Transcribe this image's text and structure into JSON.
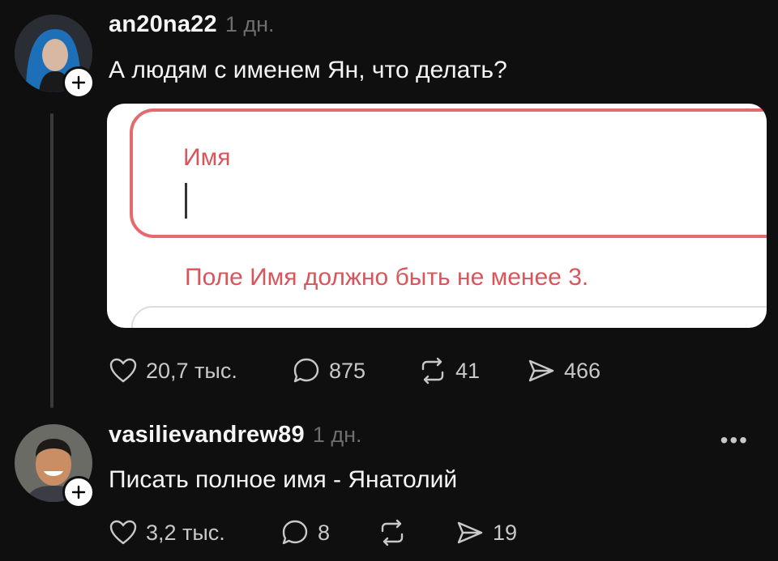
{
  "posts": [
    {
      "username": "an20na22",
      "time": "1 дн.",
      "text": "А людям с именем Ян, что делать?",
      "embed": {
        "field_label": "Имя",
        "error_text": "Поле Имя должно быть не менее 3."
      },
      "stats": {
        "likes": "20,7 тыс.",
        "comments": "875",
        "reposts": "41",
        "shares": "466"
      }
    },
    {
      "username": "vasilievandrew89",
      "time": "1 дн.",
      "text": "Писать полное имя - Янатолий",
      "stats": {
        "likes": "3,2 тыс.",
        "comments": "8",
        "reposts": "",
        "shares": "19"
      }
    }
  ],
  "more_label": "•••",
  "colors": {
    "background": "#0f0f0f",
    "error": "#d9555c",
    "muted": "#6e6e6e"
  }
}
